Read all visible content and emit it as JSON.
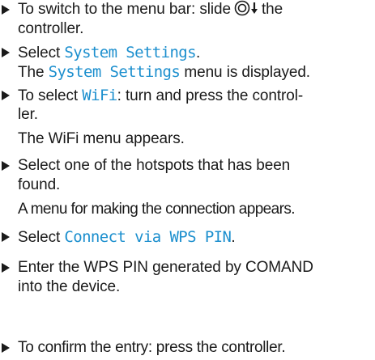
{
  "steps": [
    {
      "pre": "To switch to the menu bar: slide",
      "post": "the",
      "cont": "controller.",
      "icon": "controller-slide-down-icon"
    },
    {
      "pre": "Select ",
      "hl": "System Settings",
      "post": ".",
      "res_pre": "The ",
      "res_hl": "System Settings",
      "res_post": " menu is displayed."
    },
    {
      "pre": "To select ",
      "hl": "WiFi",
      "post": ": turn and press the control-",
      "cont": "ler.",
      "result": "The WiFi menu appears."
    },
    {
      "l1": "Select one of the hotspots that has been",
      "l2": "found.",
      "result": "A menu for making the connection appears."
    },
    {
      "pre": "Select ",
      "hl": "Connect via WPS PIN",
      "post": "."
    },
    {
      "l1": "Enter the WPS PIN generated by COMAND",
      "l2": "into the device."
    },
    {
      "l1": "To confirm the entry: press the controller."
    }
  ],
  "colors": {
    "highlight": "#1c8fce",
    "text": "#1a1a1a"
  }
}
